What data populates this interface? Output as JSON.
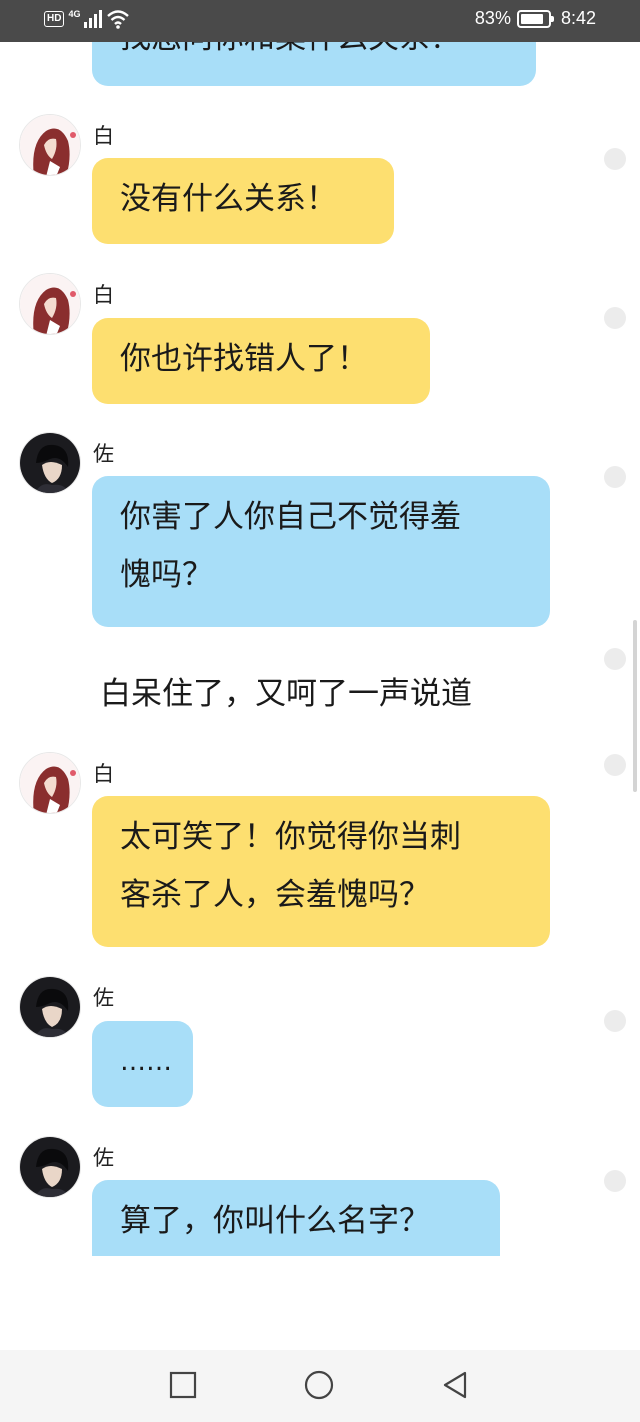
{
  "status_bar": {
    "hd_label": "HD",
    "network_label": "4G",
    "battery_percent_text": "83%",
    "battery_level": 0.83,
    "time": "8:42",
    "icons": [
      "signal-icon",
      "wifi-icon",
      "battery-icon"
    ]
  },
  "colors": {
    "bubble_yellow": "#fddf70",
    "bubble_blue": "#a8def8",
    "status_bar_bg": "#4a4a4a",
    "nav_bar_bg": "#f5f5f5"
  },
  "chat": {
    "messages": [
      {
        "sender": "",
        "text": "找您问你和案什么关系？",
        "color": "blue"
      },
      {
        "sender": "白",
        "text": "没有什么关系！",
        "color": "yellow"
      },
      {
        "sender": "白",
        "text": "你也许找错人了！",
        "color": "yellow"
      },
      {
        "sender": "佐",
        "lines": [
          "你害了人你自己不觉得羞",
          "愧吗？"
        ],
        "color": "blue"
      },
      {
        "narration": "白呆住了，又呵了一声说道"
      },
      {
        "sender": "白",
        "lines": [
          "太可笑了！你觉得你当刺",
          "客杀了人，会羞愧吗？"
        ],
        "color": "yellow"
      },
      {
        "sender": "佐",
        "text": "……",
        "color": "blue"
      },
      {
        "sender": "佐",
        "text": "算了，你叫什么名字？",
        "color": "blue"
      }
    ]
  },
  "nav_bar": {
    "buttons": [
      "recent-apps",
      "home",
      "back"
    ]
  }
}
